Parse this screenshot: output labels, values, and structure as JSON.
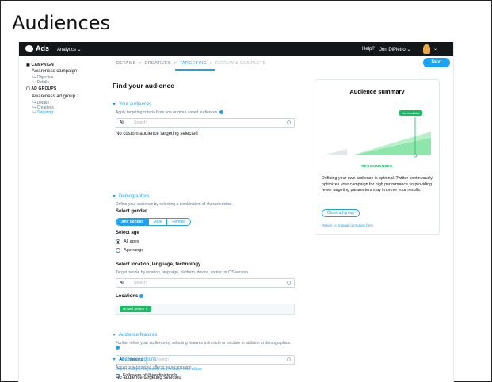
{
  "slide": {
    "title": "Audiences"
  },
  "topbar": {
    "brand": "Ads",
    "analytics": "Analytics ⌄",
    "help": "Help?",
    "user": "Jon DiPietro ⌄"
  },
  "sidebar": {
    "campaign_head": "CAMPAIGN",
    "campaign_name": "Awareness campaign",
    "campaign_steps": [
      "↪ Objective",
      "↪ Details"
    ],
    "adgroups_head": "AD GROUPS",
    "adgroup_name": "Awareness ad group 1",
    "adgroup_steps": [
      "↪ Details",
      "↪ Creatives",
      "↪ Targeting"
    ]
  },
  "steps": {
    "details": "DETAILS",
    "creatives": "CREATIVES",
    "targeting": "TARGETING",
    "review": "REVIEW & COMPLETE",
    "sep": ">"
  },
  "next_label": "Next",
  "main": {
    "heading": "Find your audience",
    "your_audiences": {
      "title": "Your audiences",
      "desc": "Apply targeting criteria from one or more saved audiences.",
      "prefix": "All",
      "placeholder": "Search",
      "empty": "No custom audience targeting selected"
    },
    "demographics": {
      "title": "Demographics",
      "desc": "Define your audience by selecting a combination of characteristics.",
      "gender_label": "Select gender",
      "gender_options": [
        "Any gender",
        "Male",
        "Female"
      ],
      "age_label": "Select age",
      "age_options": [
        "All ages",
        "Age range"
      ],
      "location_label": "Select location, language, technology",
      "location_desc": "Target people by location, language, platform, device, carrier, or OS version.",
      "prefix": "All",
      "placeholder": "Search",
      "locations_label": "Locations",
      "location_chip": "United States ✕"
    },
    "audience_features": {
      "title": "Audience features",
      "desc": "Further refine your audience by selecting features to include or exclude in addition to demographics.",
      "prefix": "All › Interests",
      "placeholder": "Search",
      "import_link": "Import multiple keywords and follower look-alikes",
      "empty": "No audience targeting selected"
    },
    "additional_options": {
      "title": "Additional options",
      "desc": "Adjust how targeting affects your campaign.",
      "followers": "Followers of @jondipietronh"
    }
  },
  "summary": {
    "title": "Audience summary",
    "not_available": "Not available",
    "recommended": "RECOMMENDED",
    "desc": "Defining your own audience is optional. Twitter continuously optimizes your campaign for high performance so providing fewer targeting parameters may improve your results.",
    "clone": "Clone ad group",
    "return": "Return to original campaign form"
  },
  "colors": {
    "accent": "#1da1f2",
    "green": "#17bf63",
    "topbar": "#14171a"
  },
  "icons": [
    "twitter-bird-icon",
    "search-icon",
    "info-icon",
    "caret-down-icon",
    "remove-icon"
  ]
}
